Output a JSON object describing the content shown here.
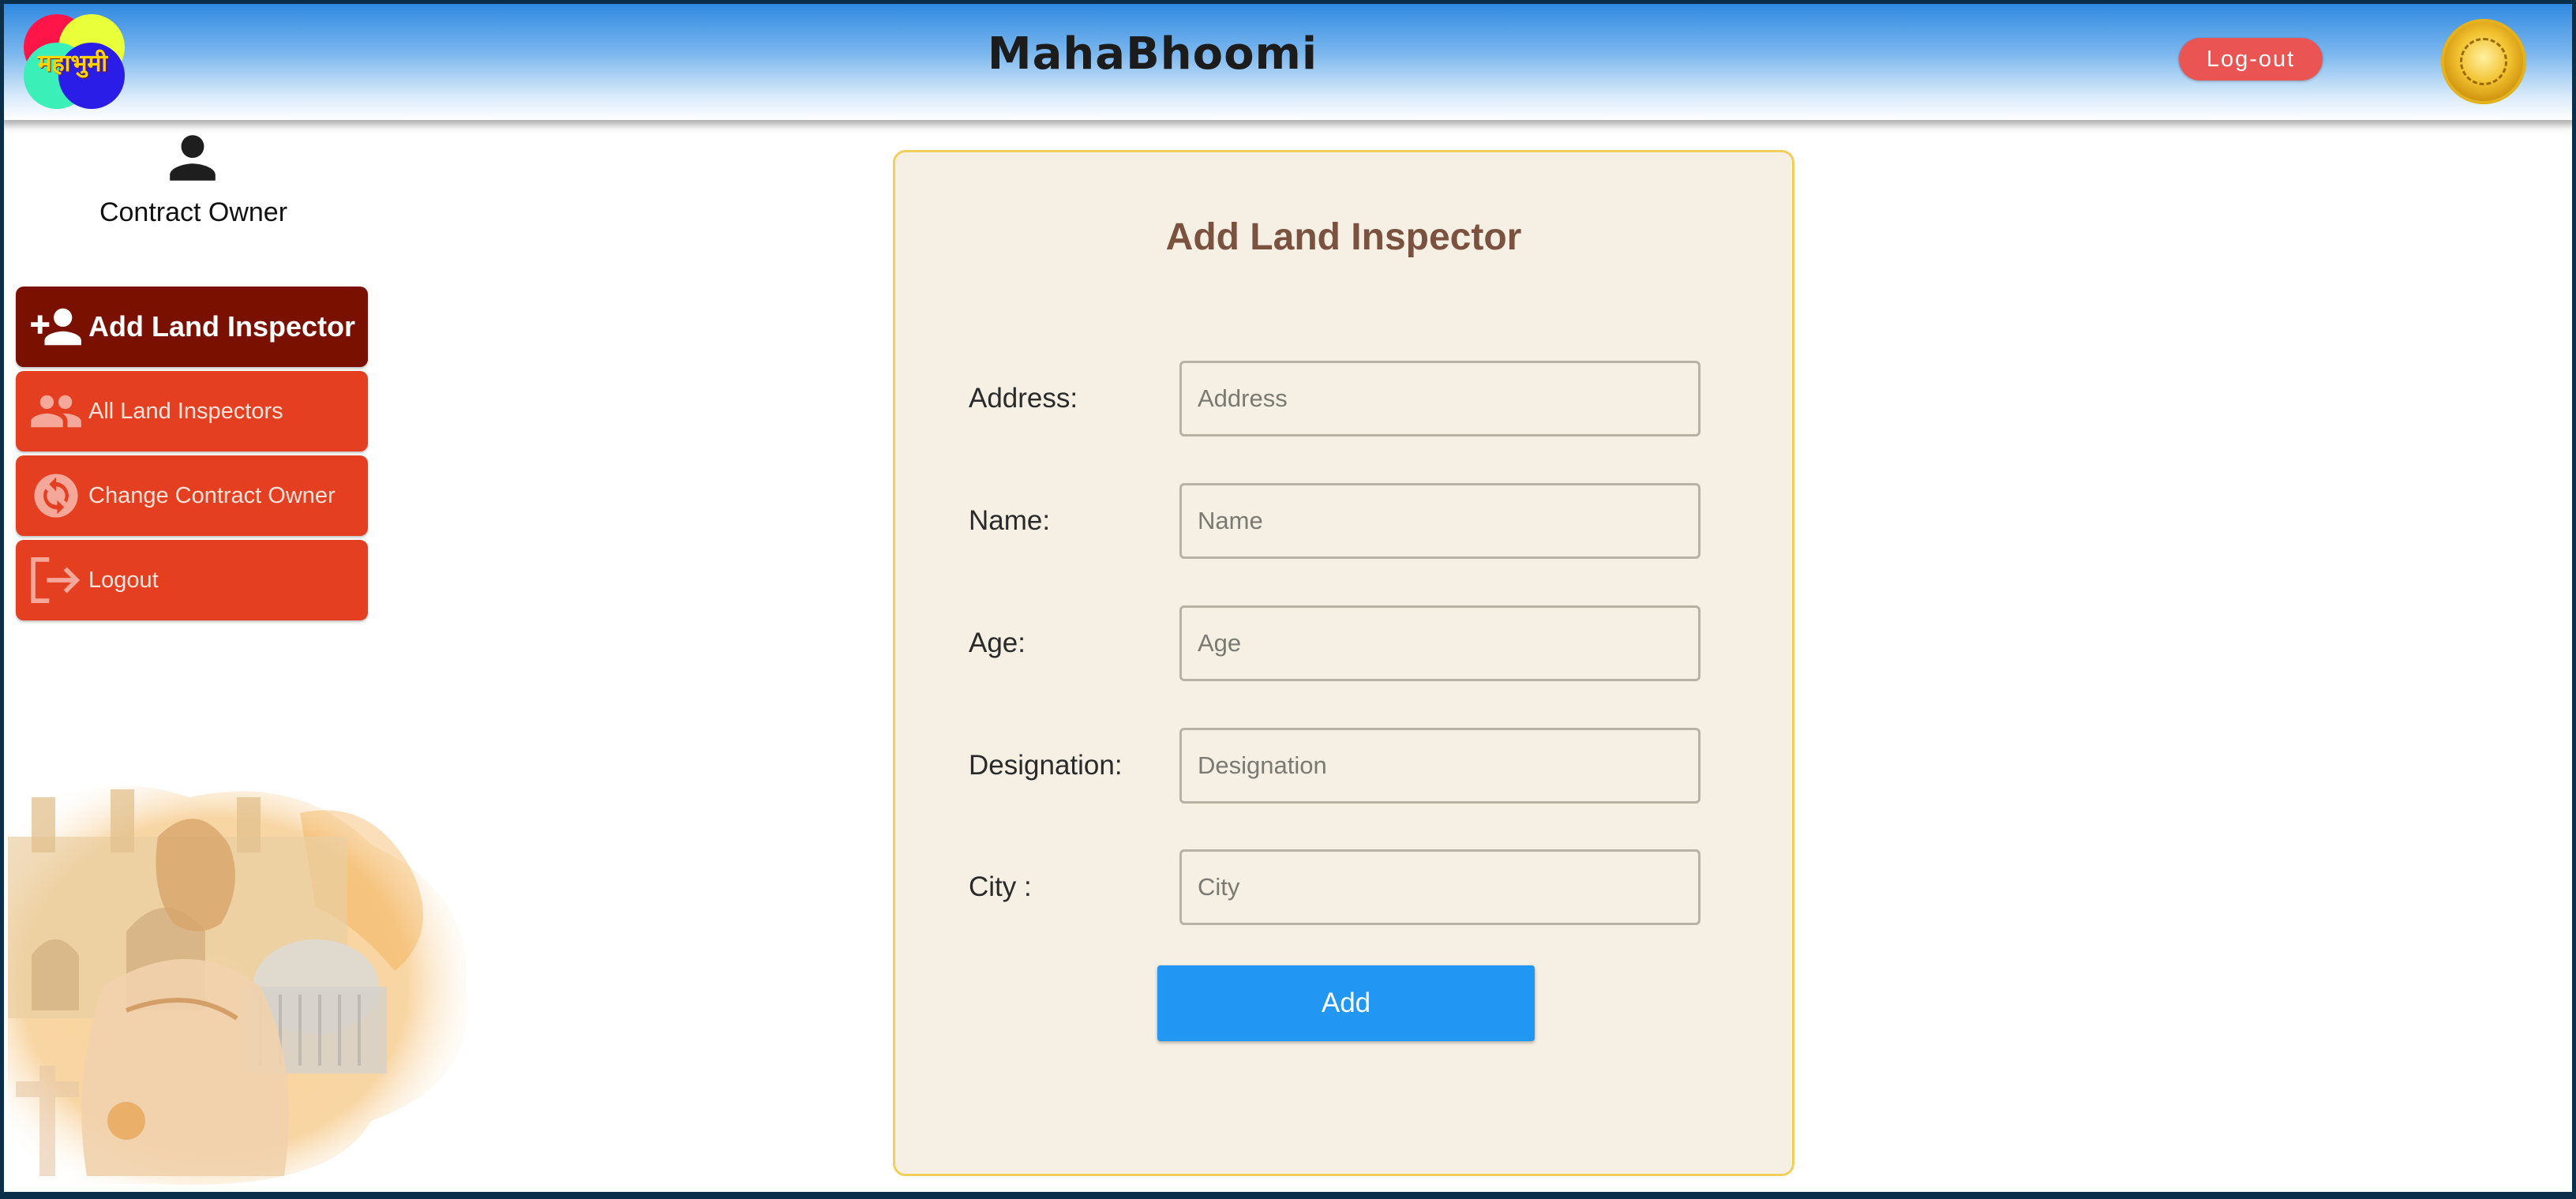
{
  "header": {
    "logo_text": "महाभुमी",
    "brand": "MahaBhoomi",
    "logout_label": "Log-out"
  },
  "sidebar": {
    "profile_name": "Contract Owner",
    "items": [
      {
        "label": "Add Land Inspector",
        "icon": "person-add-icon",
        "active": true
      },
      {
        "label": "All Land Inspectors",
        "icon": "people-icon",
        "active": false
      },
      {
        "label": "Change Contract Owner",
        "icon": "sync-icon",
        "active": false
      },
      {
        "label": "Logout",
        "icon": "logout-icon",
        "active": false
      }
    ]
  },
  "form": {
    "title": "Add Land Inspector",
    "fields": [
      {
        "label": "Address:",
        "placeholder": "Address",
        "value": ""
      },
      {
        "label": "Name:",
        "placeholder": "Name",
        "value": ""
      },
      {
        "label": "Age:",
        "placeholder": "Age",
        "value": ""
      },
      {
        "label": "Designation:",
        "placeholder": "Designation",
        "value": ""
      },
      {
        "label": "City :",
        "placeholder": "City",
        "value": ""
      }
    ],
    "submit_label": "Add"
  },
  "colors": {
    "menu_active": "#7a1100",
    "menu_default": "#e53f21",
    "card_bg": "#f5efe4",
    "card_border": "#f0cf5c",
    "primary_button": "#2196f3",
    "logout_pill": "#ea5452"
  }
}
